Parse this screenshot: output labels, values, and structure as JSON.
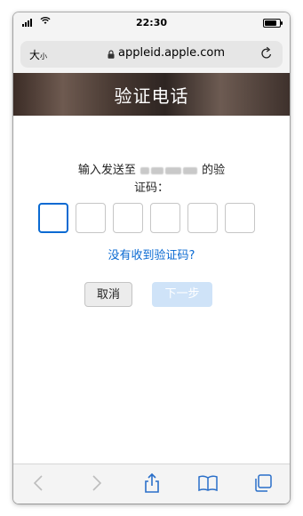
{
  "status_bar": {
    "time": "22:30"
  },
  "address_bar": {
    "text_size_label": "大",
    "text_size_small": "小",
    "url": "appleid.apple.com"
  },
  "header": {
    "title": "验证电话"
  },
  "verification": {
    "prompt_before": "输入发送至",
    "prompt_after": "的验",
    "prompt_line2": "证码：",
    "code_boxes": [
      "",
      "",
      "",
      "",
      "",
      ""
    ],
    "resend_link": "没有收到验证码?",
    "cancel_label": "取消",
    "next_label": "下一步"
  },
  "toolbar": {
    "items": [
      "back-icon",
      "forward-icon",
      "share-icon",
      "bookmarks-icon",
      "tabs-icon"
    ]
  },
  "colors": {
    "accent": "#0a6ad2",
    "next_disabled": "#cfe3f8"
  }
}
